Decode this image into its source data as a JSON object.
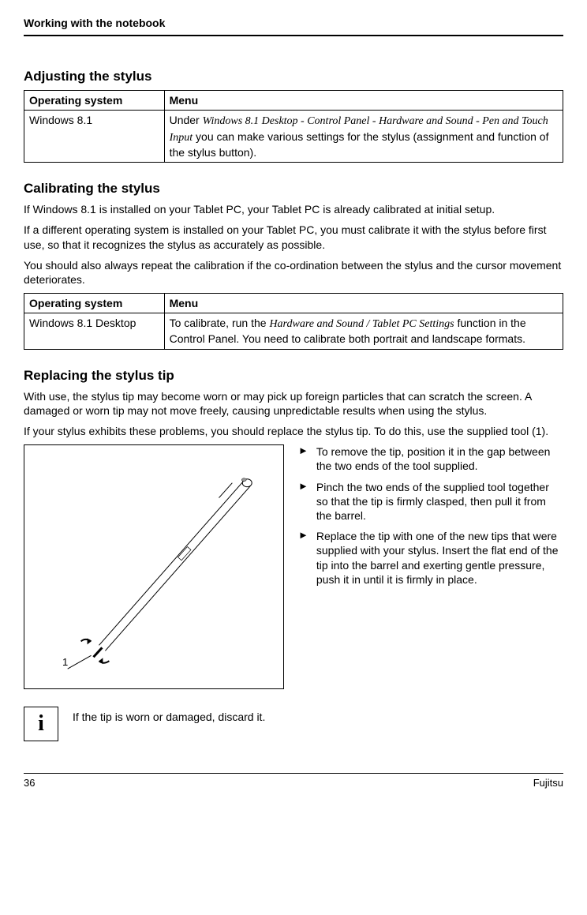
{
  "header": {
    "title": "Working with the notebook"
  },
  "sec1": {
    "heading": "Adjusting the stylus",
    "table": {
      "h1": "Operating system",
      "h2": "Menu",
      "r1c1": "Windows 8.1",
      "r1c2_prefix": "Under ",
      "r1c2_italic": "Windows 8.1 Desktop - Control Panel - Hardware and Sound - Pen and Touch Input",
      "r1c2_suffix": " you can make various settings for the stylus (assignment and function of the stylus button)."
    }
  },
  "sec2": {
    "heading": "Calibrating the stylus",
    "p1": "If Windows 8.1 is installed on your Tablet PC, your Tablet PC is already calibrated at initial setup.",
    "p2": "If a different operating system is installed on your Tablet PC, you must calibrate it with the stylus before first use, so that it recognizes the stylus as accurately as possible.",
    "p3": "You should also always repeat the calibration if the co-ordination between the stylus and the cursor movement deteriorates.",
    "table": {
      "h1": "Operating system",
      "h2": "Menu",
      "r1c1": "Windows 8.1 Desktop",
      "r1c2_prefix": "To calibrate, run the ",
      "r1c2_italic": "Hardware and Sound / Tablet PC Settings",
      "r1c2_suffix": " function in the Control Panel. You need to calibrate both portrait and landscape formats."
    }
  },
  "sec3": {
    "heading": "Replacing the stylus tip",
    "p1": "With use, the stylus tip may become worn or may pick up foreign particles that can scratch the screen. A damaged or worn tip may not move freely, causing unpredictable results when using the stylus.",
    "p2": "If your stylus exhibits these problems, you should replace the stylus tip. To do this, use the supplied tool (1).",
    "steps": [
      "To remove the tip, position it in the gap between the two ends of the tool supplied.",
      "Pinch the two ends of the supplied tool together so that the tip is firmly clasped, then pull it from the barrel.",
      "Replace the tip with one of the new tips that were supplied with your stylus. Insert the flat end of the tip into the barrel and exerting gentle pressure, push it in until it is firmly in place."
    ],
    "image_label": "1",
    "info": "If the tip is worn or damaged, discard it."
  },
  "footer": {
    "page": "36",
    "brand": "Fujitsu"
  }
}
